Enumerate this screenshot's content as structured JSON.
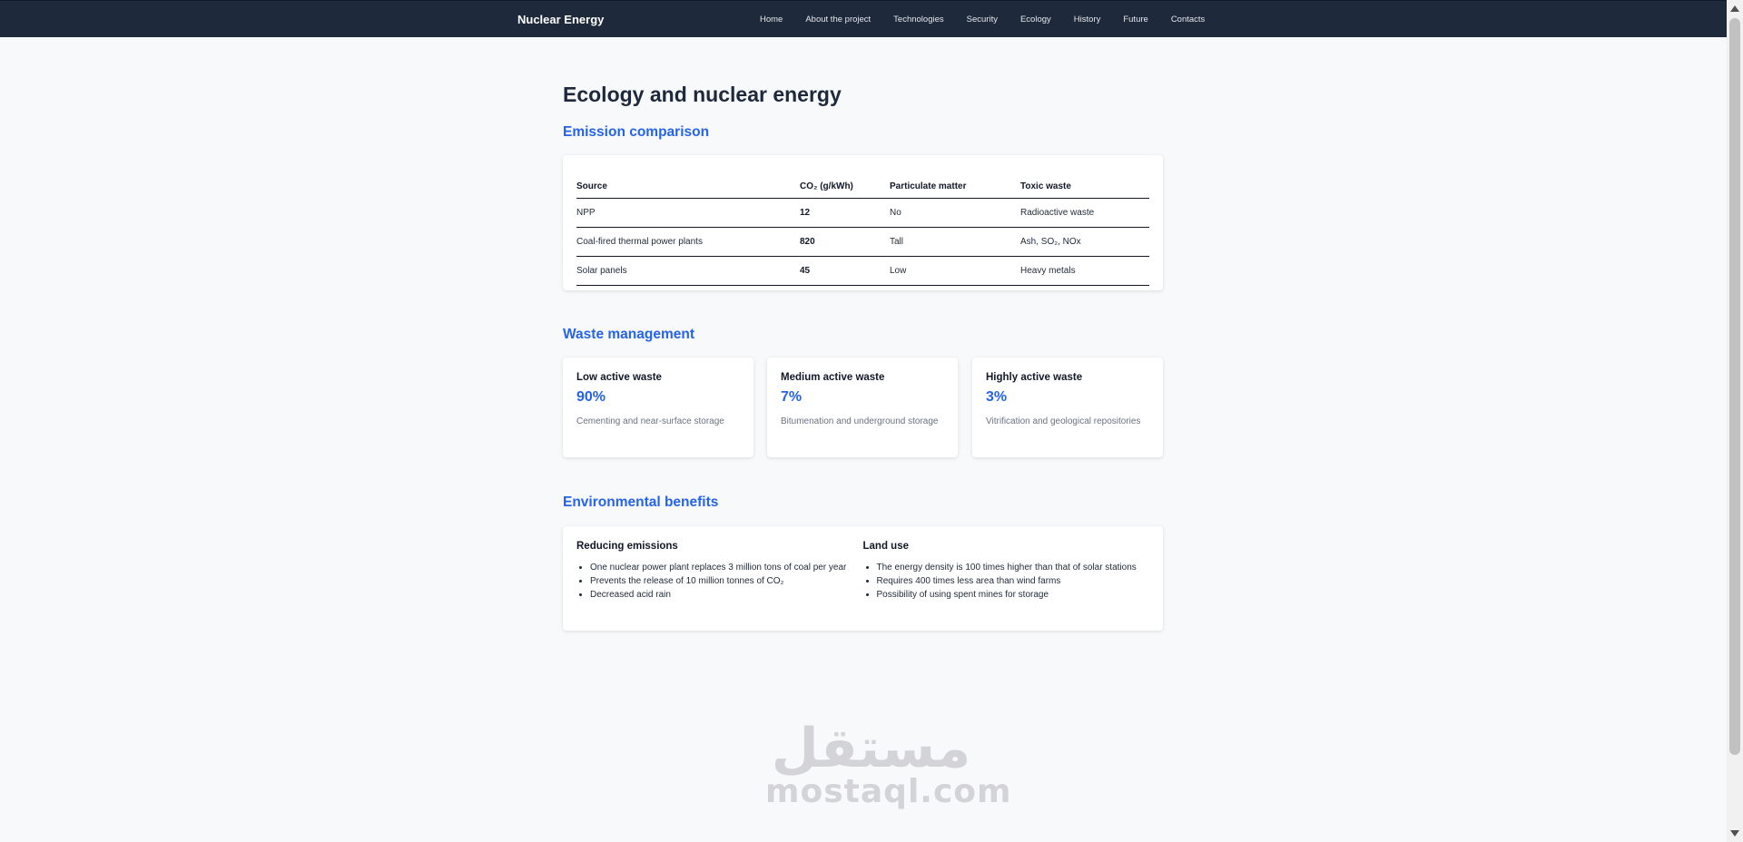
{
  "nav": {
    "brand": "Nuclear Energy",
    "links": [
      "Home",
      "About the project",
      "Technologies",
      "Security",
      "Ecology",
      "History",
      "Future",
      "Contacts"
    ]
  },
  "page": {
    "title": "Ecology and nuclear energy"
  },
  "emission": {
    "title": "Emission comparison",
    "headers": [
      "Source",
      "CO₂ (g/kWh)",
      "Particulate matter",
      "Toxic waste"
    ],
    "rows": [
      [
        "NPP",
        "12",
        "No",
        "Radioactive waste"
      ],
      [
        "Coal-fired thermal power plants",
        "820",
        "Tall",
        "Ash, SO₂, NOx"
      ],
      [
        "Solar panels",
        "45",
        "Low",
        "Heavy metals"
      ]
    ]
  },
  "waste": {
    "title": "Waste management",
    "cards": [
      {
        "title": "Low active waste",
        "percent": "90%",
        "desc": "Cementing and near-surface storage"
      },
      {
        "title": "Medium active waste",
        "percent": "7%",
        "desc": "Bitumenation and underground storage"
      },
      {
        "title": "Highly active waste",
        "percent": "3%",
        "desc": "Vitrification and geological repositories"
      }
    ]
  },
  "benefits": {
    "title": "Environmental benefits",
    "columns": [
      {
        "title": "Reducing emissions",
        "items": [
          "One nuclear power plant replaces 3 million tons of coal per year",
          "Prevents the release of 10 million tonnes of CO₂",
          "Decreased acid rain"
        ]
      },
      {
        "title": "Land use",
        "items": [
          "The energy density is 100 times higher than that of solar stations",
          "Requires 400 times less area than wind farms",
          "Possibility of using spent mines for storage"
        ]
      }
    ]
  },
  "watermark": {
    "arabic": "مستقل",
    "latin": "mostaql.com"
  },
  "colors": {
    "navbar": "#1e293b",
    "accent": "#2563eb",
    "background": "#f8f9fb"
  },
  "icons": [
    "scroll-up-arrow-icon",
    "scroll-down-arrow-icon"
  ]
}
